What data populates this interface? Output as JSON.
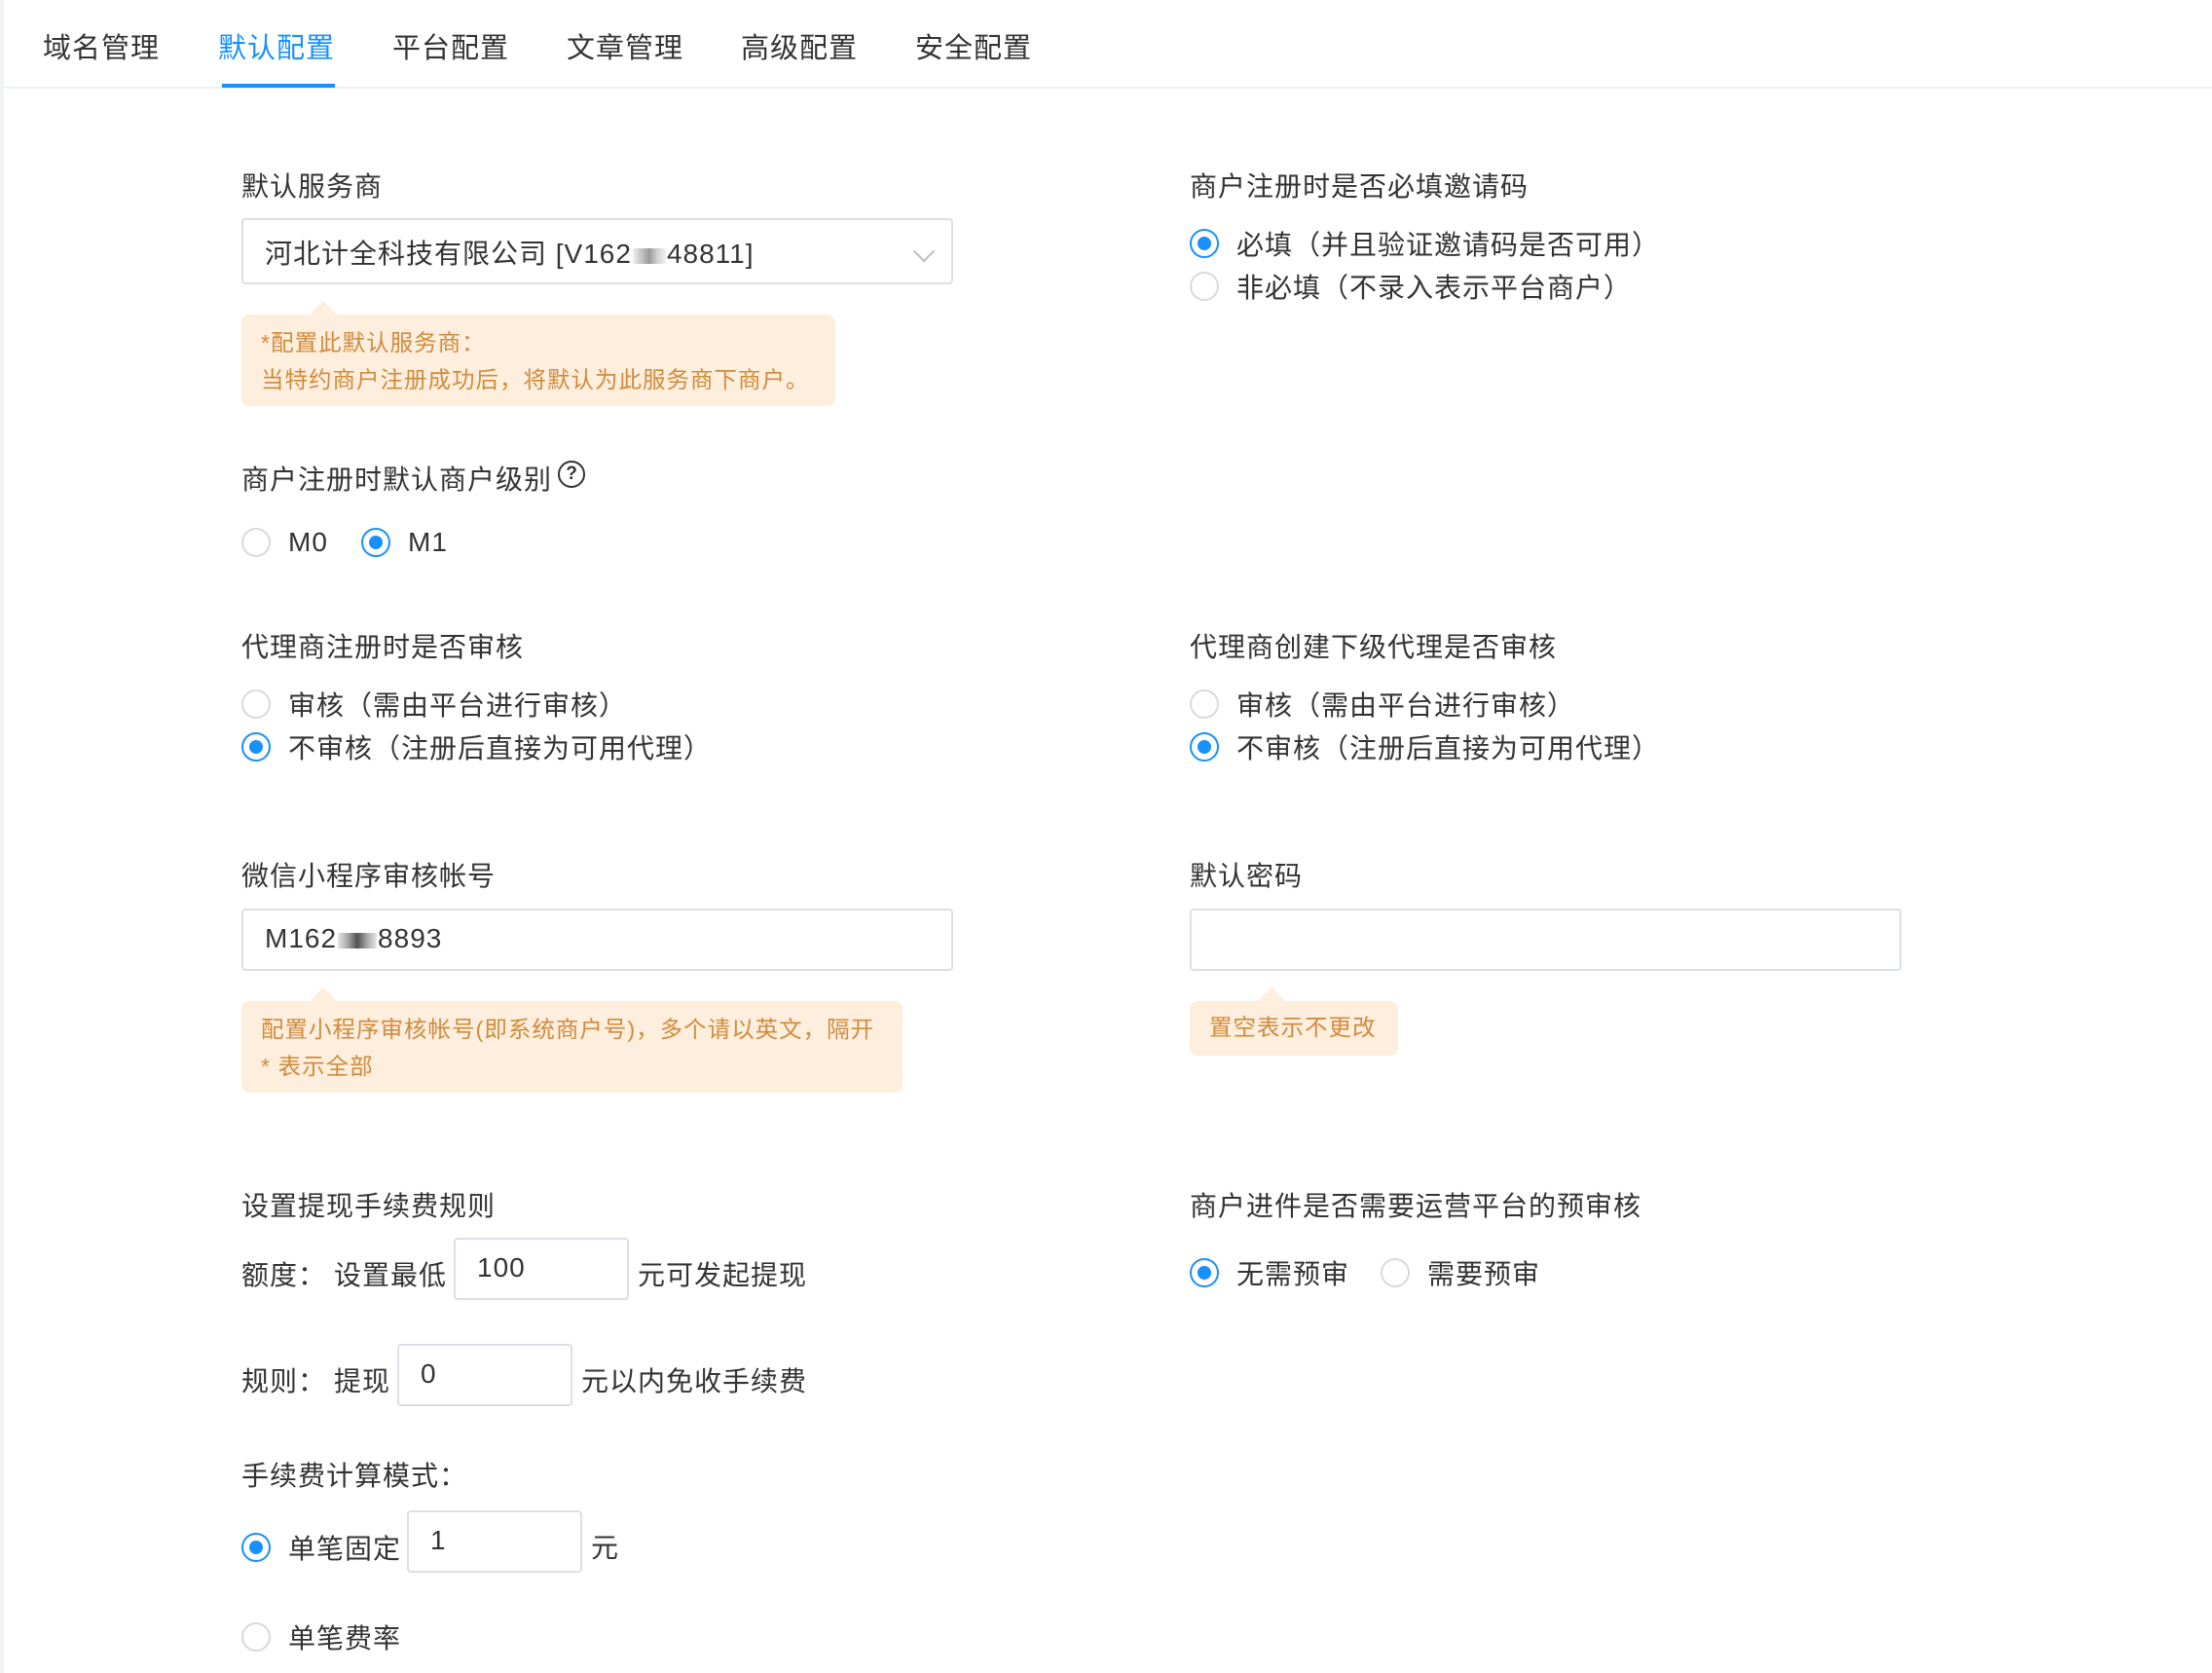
{
  "tabs": [
    {
      "label": "域名管理"
    },
    {
      "label": "默认配置",
      "active": true
    },
    {
      "label": "平台配置"
    },
    {
      "label": "文章管理"
    },
    {
      "label": "高级配置"
    },
    {
      "label": "安全配置"
    }
  ],
  "default_provider": {
    "label": "默认服务商",
    "value_prefix": "河北计全科技有限公司 [V162",
    "value_suffix": "48811]",
    "tip_line1": "*配置此默认服务商：",
    "tip_line2": "当特约商户注册成功后，将默认为此服务商下商户。"
  },
  "invite_code": {
    "label": "商户注册时是否必填邀请码",
    "options": [
      "必填（并且验证邀请码是否可用）",
      "非必填（不录入表示平台商户）"
    ],
    "selected": 0
  },
  "merchant_level": {
    "label": "商户注册时默认商户级别",
    "help_icon": "question-circle-icon",
    "options": [
      "M0",
      "M1"
    ],
    "selected": 1
  },
  "agent_review": {
    "label": "代理商注册时是否审核",
    "options": [
      "审核（需由平台进行审核）",
      "不审核（注册后直接为可用代理）"
    ],
    "selected": 1
  },
  "sub_agent_review": {
    "label": "代理商创建下级代理是否审核",
    "options": [
      "审核（需由平台进行审核）",
      "不审核（注册后直接为可用代理）"
    ],
    "selected": 1
  },
  "miniprogram_account": {
    "label": "微信小程序审核帐号",
    "value_prefix": "M162",
    "value_suffix": "8893",
    "tip_line1": "配置小程序审核帐号(即系统商户号)，多个请以英文，隔开",
    "tip_line2": "* 表示全部"
  },
  "default_password": {
    "label": "默认密码",
    "value": "",
    "tip": "置空表示不更改"
  },
  "withdraw_fee": {
    "label": "设置提现手续费规则",
    "amount_label": "额度：",
    "amount_prefix": "设置最低",
    "amount_value": "100",
    "amount_suffix": "元可发起提现",
    "rule_label": "规则：",
    "rule_prefix": "提现",
    "rule_value": "0",
    "rule_suffix": "元以内免收手续费",
    "mode_label": "手续费计算模式：",
    "mode_options": [
      "单笔固定",
      "单笔费率"
    ],
    "mode_selected": 0,
    "fixed_value": "1",
    "fixed_unit": "元"
  },
  "pre_review": {
    "label": "商户进件是否需要运营平台的预审核",
    "options": [
      "无需预审",
      "需要预审"
    ],
    "selected": 0
  },
  "colors": {
    "primary": "#1890ff",
    "tip_bg": "#fdeedd",
    "tip_text": "#d08b3b"
  }
}
